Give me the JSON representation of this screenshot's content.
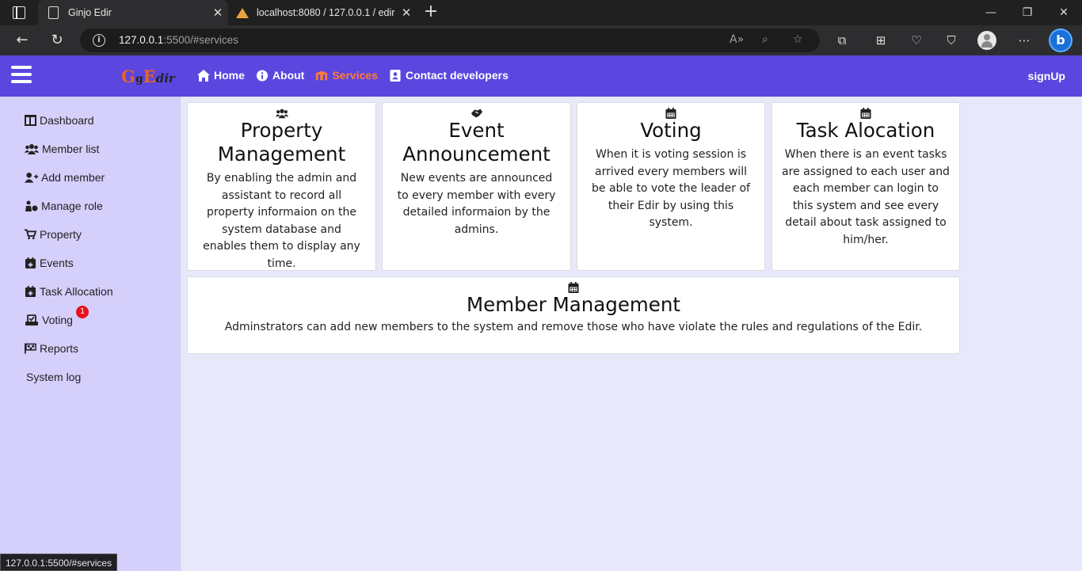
{
  "browser": {
    "tabs": [
      {
        "title": "Ginjo Edir"
      },
      {
        "title": "localhost:8080 / 127.0.0.1 / edir /"
      }
    ],
    "url_host": "127.0.0.1",
    "url_rest": ":5500/#services",
    "status_url": "127.0.0.1:5500/#services"
  },
  "navbar": {
    "logo": {
      "g1": "G",
      "g2": "g",
      "e": "E",
      "dir": "dir"
    },
    "links": [
      {
        "label": "Home",
        "icon": "home-icon"
      },
      {
        "label": "About",
        "icon": "info-icon"
      },
      {
        "label": "Services",
        "icon": "services-icon",
        "active": true
      },
      {
        "label": "Contact developers",
        "icon": "contact-icon"
      }
    ],
    "signup": "signUp",
    "colors": {
      "bar": "#5b47e0",
      "active": "#ff7a3c"
    }
  },
  "sidebar": {
    "items": [
      {
        "label": "Dashboard",
        "icon": "dashboard-icon"
      },
      {
        "label": "Member list",
        "icon": "members-icon"
      },
      {
        "label": "Add member",
        "icon": "add-user-icon"
      },
      {
        "label": "Manage role",
        "icon": "role-icon"
      },
      {
        "label": "Property",
        "icon": "cart-icon"
      },
      {
        "label": "Events",
        "icon": "calendar-plus-icon"
      },
      {
        "label": "Task Allocation",
        "icon": "calendar-plus-icon"
      },
      {
        "label": "Voting",
        "icon": "vote-icon"
      },
      {
        "label": "Reports",
        "icon": "flag-icon"
      },
      {
        "label": "System log",
        "icon": ""
      }
    ],
    "voting_badge": "1"
  },
  "services": [
    {
      "title": "Property Management",
      "icon": "users-icon",
      "text": "By enabling the admin and assistant to record all property informaion on the system database and enables them to display any time."
    },
    {
      "title": "Event Announcement",
      "icon": "handshake-icon",
      "text": "New events are announced to every member with every detailed informaion by the admins."
    },
    {
      "title": "Voting",
      "icon": "calendar-icon",
      "text": "When it is voting session is arrived every members will be able to vote the leader of their Edir by using this system."
    },
    {
      "title": "Task Alocation",
      "icon": "calendar-icon",
      "text": "When there is an event tasks are assigned to each user and each member can login to this system and see every detail about task assigned to him/her."
    },
    {
      "title": "Member Management",
      "icon": "calendar-icon",
      "text": "Adminstrators can add new members to the system and remove those who have violate the rules and regulations of the Edir."
    }
  ]
}
